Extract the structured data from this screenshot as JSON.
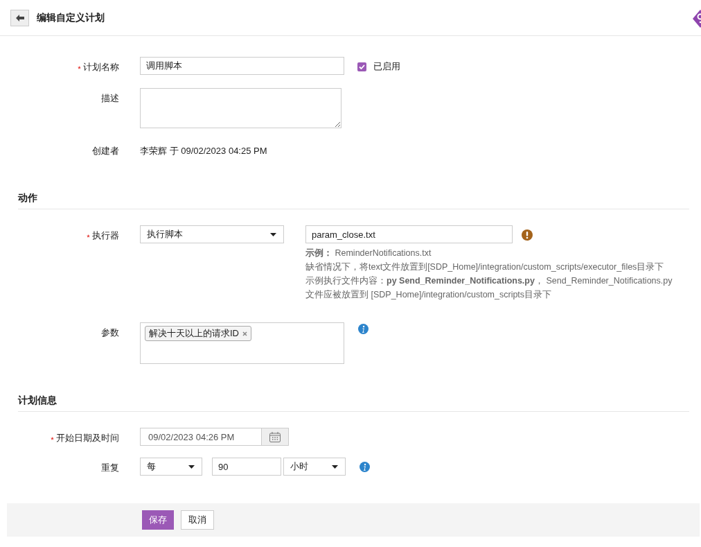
{
  "header": {
    "title": "编辑自定义计划"
  },
  "details": {
    "name": {
      "label": "计划名称",
      "required": true,
      "value": "调用脚本"
    },
    "enabled": {
      "label": "已启用",
      "checked": true
    },
    "description": {
      "label": "描述",
      "required": false
    },
    "created_by": {
      "label": "创建者",
      "required": false,
      "value": "李荣辉 于 09/02/2023 04:25 PM"
    }
  },
  "action": {
    "heading": "动作",
    "executor": {
      "label": "执行器",
      "required": true,
      "value": "执行脚本",
      "file": "param_close.txt",
      "hints": [
        "**示例：** ReminderNotifications.txt",
        "缺省情况下，将text文件放置到[SDP_Home]/integration/custom_scripts/executor_files目录下",
        "示例执行文件内容：**py Send_Reminder_Notifications.py**， Send_Reminder_Notifications.py 文件应被放置到 [SDP_Home]/integration/custom_scripts目录下"
      ]
    },
    "parameters": {
      "label": "参数",
      "required": false,
      "tags": [
        {
          "text": "解决十天以上的请求ID"
        }
      ]
    }
  },
  "schedule": {
    "heading": "计划信息",
    "start": {
      "label": "开始日期及时间",
      "required": true,
      "value": "09/02/2023 04:26 PM"
    },
    "repeat": {
      "label": "重复",
      "required": false,
      "every": "每",
      "interval": "90",
      "unit": "小时"
    }
  },
  "buttons": [
    {
      "label": "保存",
      "kind": "primary"
    },
    {
      "label": "取消",
      "kind": "secondary"
    }
  ]
}
